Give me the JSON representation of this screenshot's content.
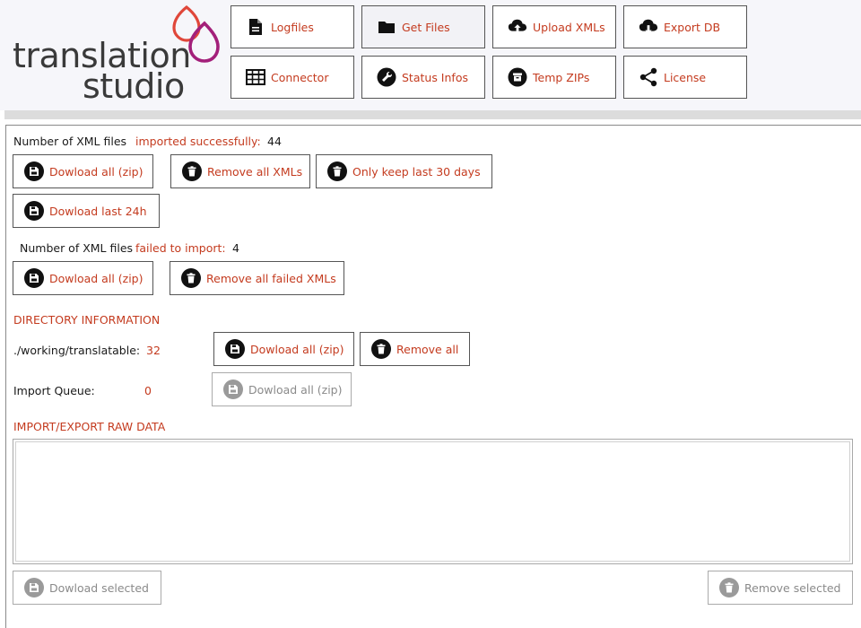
{
  "logo": {
    "line1": "translation",
    "line2": "studio"
  },
  "nav": {
    "logfiles": "Logfiles",
    "get_files": "Get Files",
    "upload_xmls": "Upload XMLs",
    "export_db": "Export DB",
    "connector": "Connector",
    "status_infos": "Status Infos",
    "temp_zips": "Temp ZIPs",
    "license": "License"
  },
  "imported": {
    "label": "Number of XML files",
    "status": "imported successfully:",
    "count": "44",
    "download_all": "Dowload all (zip)",
    "remove_all": "Remove all XMLs",
    "keep_30": "Only keep last 30 days",
    "download_24h": "Dowload last 24h"
  },
  "failed": {
    "label": "Number of XML files",
    "status": "failed to import:",
    "count": "4",
    "download_all": "Dowload all (zip)",
    "remove_all": "Remove all failed XMLs"
  },
  "directory": {
    "heading": "DIRECTORY INFORMATION",
    "translatable_label": "./working/translatable:",
    "translatable_count": "32",
    "translatable_download": "Dowload all (zip)",
    "translatable_remove": "Remove all",
    "queue_label": "Import Queue:",
    "queue_count": "0",
    "queue_download": "Dowload all (zip)"
  },
  "raw": {
    "heading": "IMPORT/EXPORT RAW DATA",
    "content": "",
    "download_selected": "Dowload selected",
    "remove_selected": "Remove selected"
  },
  "colors": {
    "accent": "#c43b1f",
    "logo_red": "#e0473a",
    "logo_magenta": "#a3207a"
  }
}
